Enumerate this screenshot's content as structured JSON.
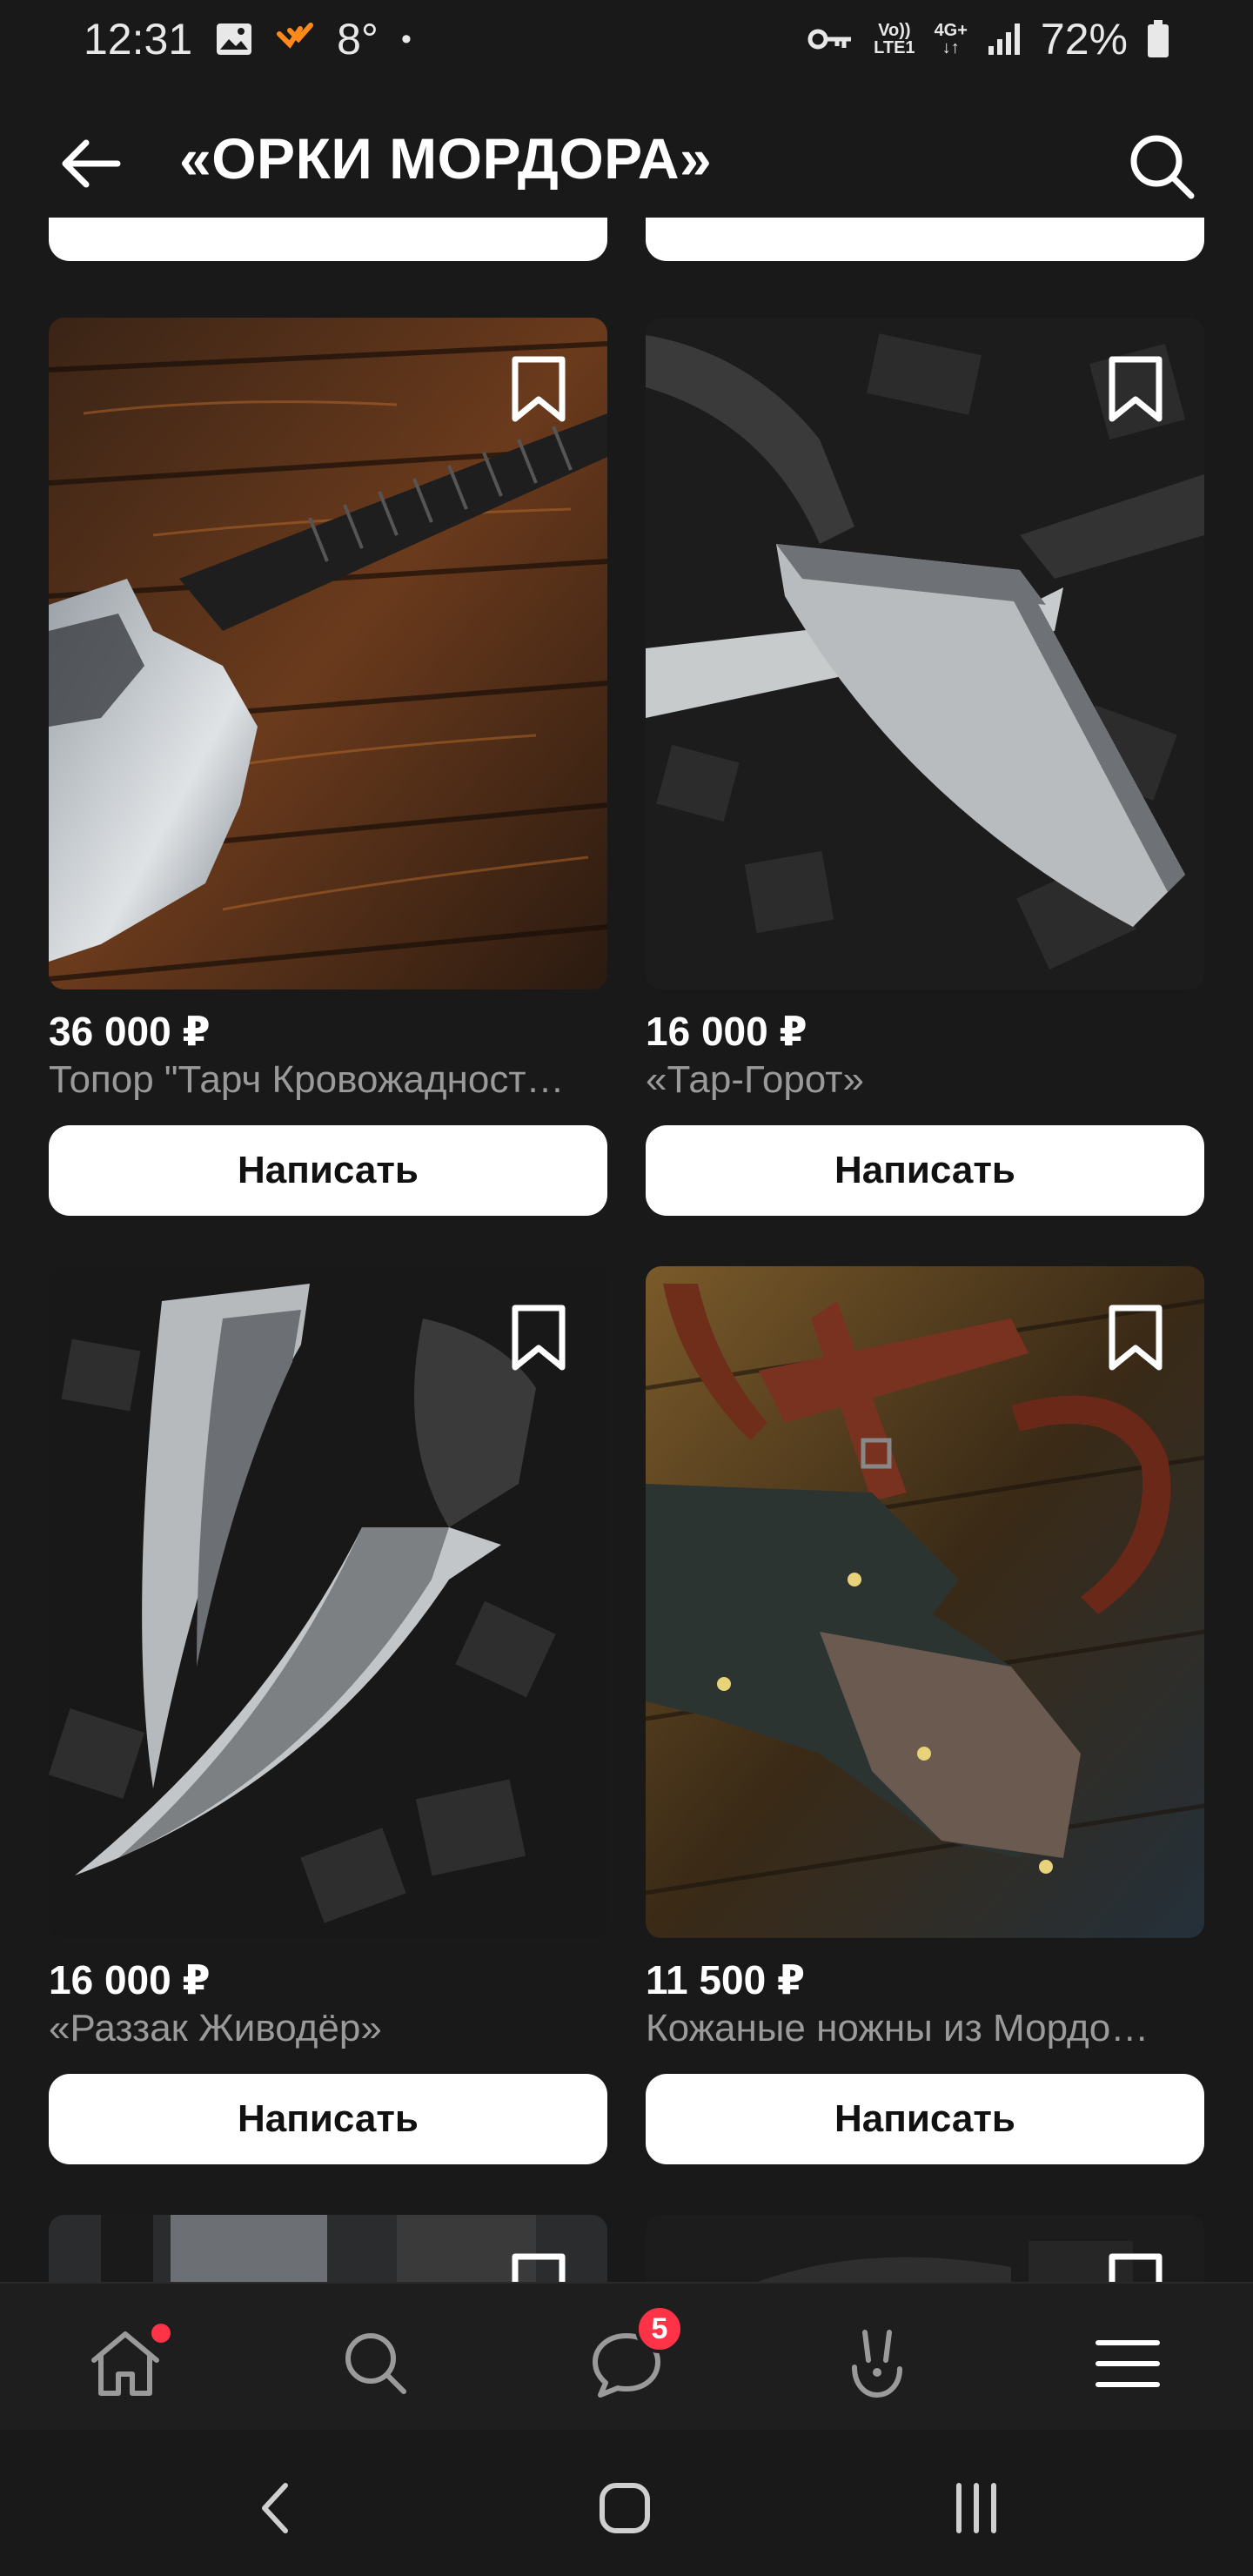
{
  "status_bar": {
    "time": "12:31",
    "temperature": "8°",
    "dot": "•",
    "network_top": "Vo))",
    "network_bottom": "LTE1",
    "data_type": "4G+",
    "battery": "72%"
  },
  "header": {
    "title": "«ОРКИ МОРДОРА»",
    "back_icon": "arrow-left-icon",
    "search_icon": "search-icon"
  },
  "products": [
    {
      "price": "36 000 ₽",
      "name": "Топор \"Тарч Кровожадност…",
      "button": "Написать",
      "image": "axe-on-wood"
    },
    {
      "price": "16 000 ₽",
      "name": "«Тар-Горот»",
      "button": "Написать",
      "image": "cleaver-on-coal"
    },
    {
      "price": "16 000 ₽",
      "name": "«Раззак Живодёр»",
      "button": "Написать",
      "image": "knife-on-coal"
    },
    {
      "price": "11 500 ₽",
      "name": "Кожаные ножны из Мордо…",
      "button": "Написать",
      "image": "leather-sheath"
    }
  ],
  "bottom_nav": {
    "items": [
      "home-icon",
      "search-icon",
      "messages-icon",
      "services-icon",
      "menu-icon"
    ],
    "messages_badge": "5"
  },
  "colors": {
    "background": "#191919",
    "accent_red": "#ff3347",
    "button_bg": "#ffffff"
  }
}
